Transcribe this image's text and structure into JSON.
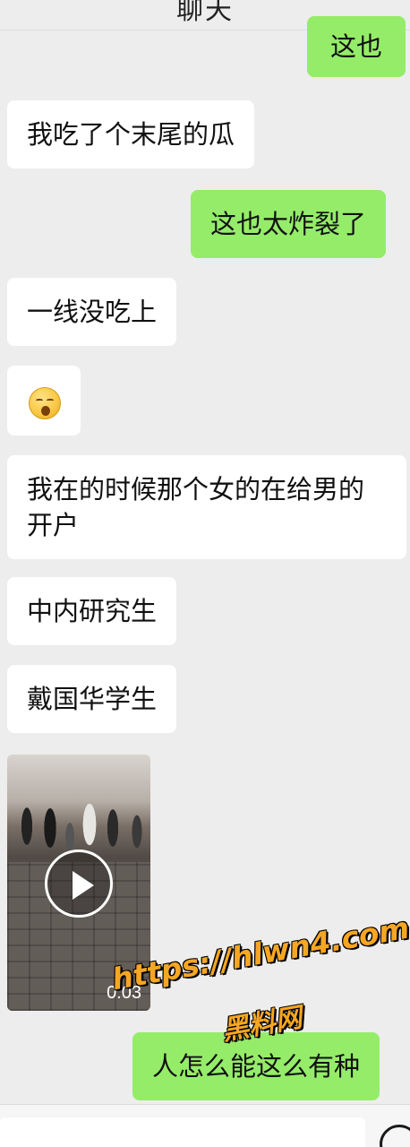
{
  "header": {
    "title": "聊天"
  },
  "messages": [
    {
      "side": "right",
      "text": "这也"
    },
    {
      "side": "left",
      "text": "我吃了个末尾的瓜"
    },
    {
      "side": "right",
      "text": "这也太炸裂了"
    },
    {
      "side": "left",
      "text": "一线没吃上"
    },
    {
      "side": "left",
      "emoji": "astonished-face-icon"
    },
    {
      "side": "left",
      "text": "我在的时候那个女的在给男的开户"
    },
    {
      "side": "left",
      "text": "中内研究生"
    },
    {
      "side": "left",
      "text": "戴国华学生"
    },
    {
      "side": "left",
      "video": {
        "duration": "0:03"
      }
    },
    {
      "side": "right",
      "text": "人怎么能这么有种"
    }
  ],
  "watermark": {
    "url": "https://hlwn4.com",
    "name": "黑料网"
  },
  "colors": {
    "background": "#ededed",
    "outgoing": "#95ec69",
    "incoming": "#ffffff"
  }
}
